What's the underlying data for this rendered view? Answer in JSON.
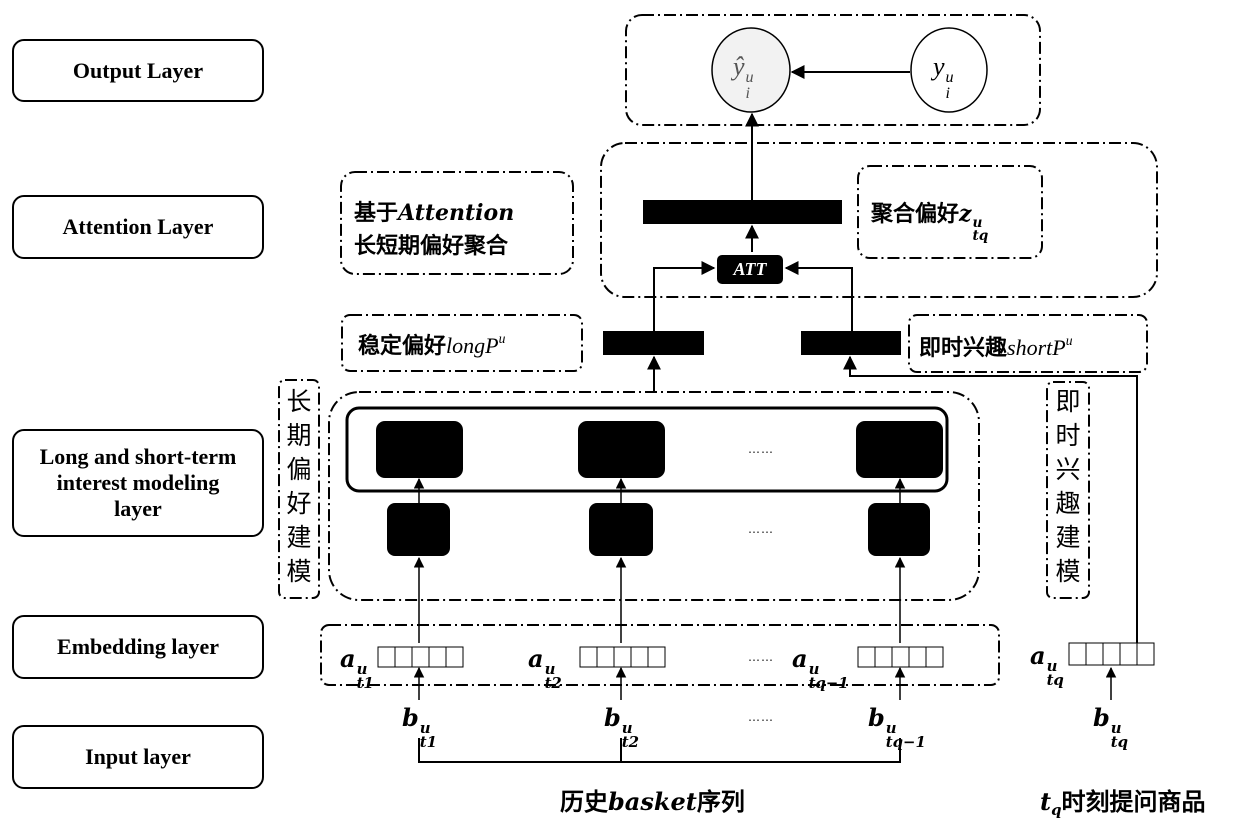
{
  "layers": {
    "output": "Output Layer",
    "attention": "Attention Layer",
    "long_short": "Long and short-term interest modeling layer",
    "embedding": "Embedding layer",
    "input": "Input layer"
  },
  "output_block": {
    "pred_symbol": "ŷ",
    "pred_sup": "u",
    "pred_sub": "i",
    "true_symbol": "y",
    "true_sup": "u",
    "true_sub": "i"
  },
  "attention_block": {
    "desc_line1_cn": "基于",
    "desc_line1_en": "Attention",
    "desc_line2": "长短期偏好聚合",
    "att_label": "ATT",
    "agg_cn": "聚合偏好",
    "agg_symbol": "z",
    "agg_sup": "u",
    "agg_sub": "tq"
  },
  "preference_labels": {
    "long_cn": "稳定偏好",
    "long_en": "longP",
    "long_sup": "u",
    "short_cn": "即时兴趣",
    "short_en": "shortP",
    "short_sup": "u"
  },
  "modeling": {
    "long_vertical": [
      "长",
      "期",
      "偏",
      "好",
      "建",
      "模"
    ],
    "short_vertical": [
      "即",
      "时",
      "兴",
      "趣",
      "建",
      "模"
    ],
    "ellipsis": "……"
  },
  "embeddings": [
    {
      "symbol": "a",
      "sup": "u",
      "sub": "t1"
    },
    {
      "symbol": "a",
      "sup": "u",
      "sub": "t2"
    },
    {
      "symbol": "a",
      "sup": "u",
      "sub": "tq−1"
    },
    {
      "symbol": "a",
      "sup": "u",
      "sub": "tq"
    }
  ],
  "inputs": [
    {
      "symbol": "b",
      "sup": "u",
      "sub": "t1"
    },
    {
      "symbol": "b",
      "sup": "u",
      "sub": "t2"
    },
    {
      "symbol": "b",
      "sup": "u",
      "sub": "tq−1"
    },
    {
      "symbol": "b",
      "sup": "u",
      "sub": "tq"
    }
  ],
  "captions": {
    "history_cn1": "历史",
    "history_en": "basket",
    "history_cn2": "序列",
    "query_symbol": "t",
    "query_sub": "q",
    "query_cn": "时刻提问商品"
  }
}
